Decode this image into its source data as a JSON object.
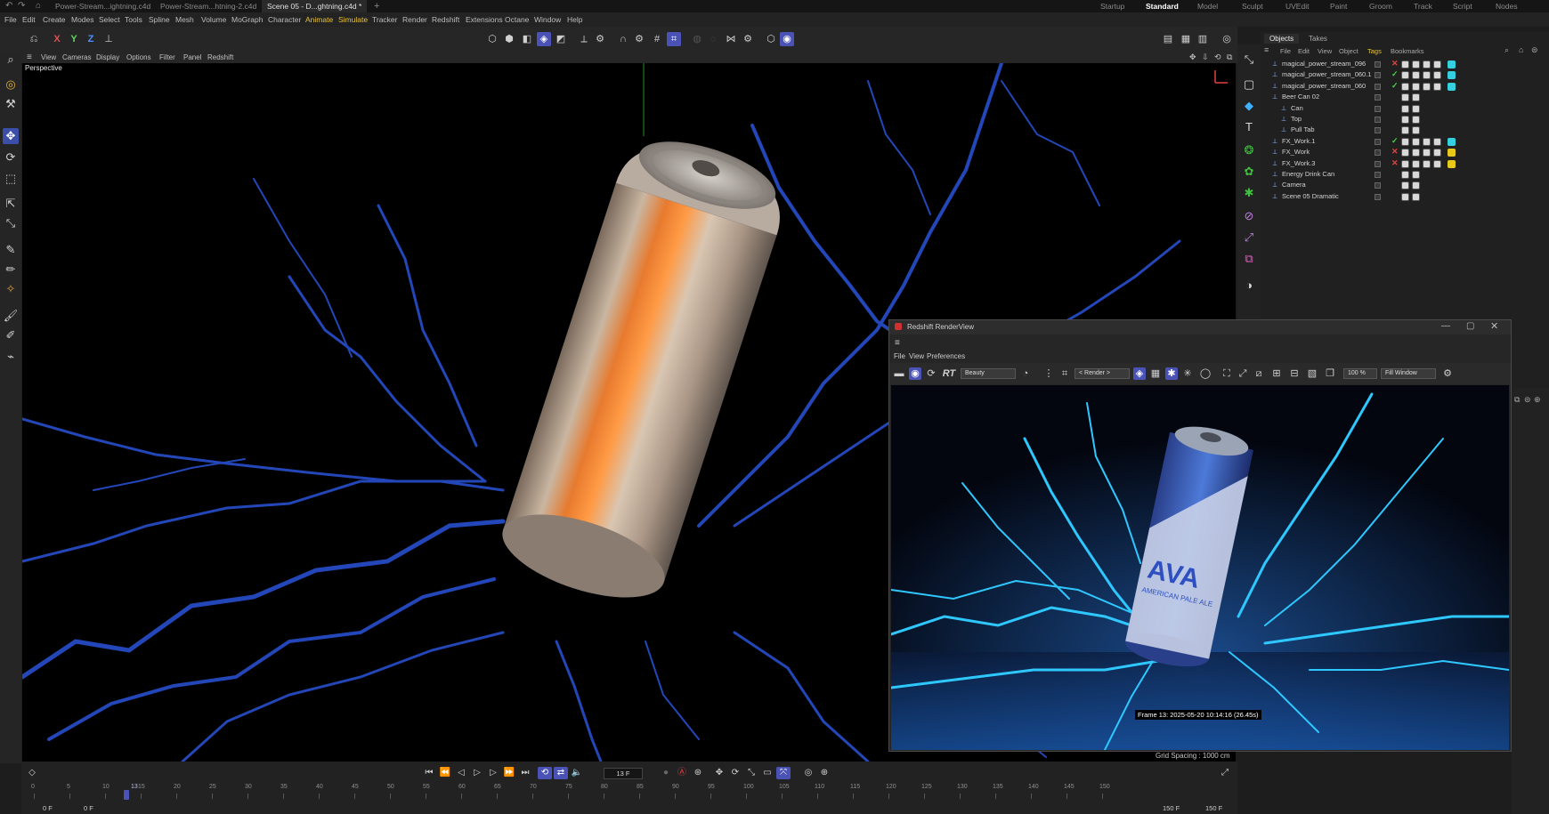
{
  "file_tabs": [
    "Power-Stream...ightning.c4d",
    "Power-Stream...htning-2.c4d",
    "Scene 05 - D...ghtning.c4d *",
    "+"
  ],
  "layouts": [
    "Startup",
    "Standard",
    "Model",
    "Sculpt",
    "UVEdit",
    "Paint",
    "Groom",
    "Track",
    "Script",
    "Nodes"
  ],
  "menu": [
    "File",
    "Edit",
    "Create",
    "Modes",
    "Select",
    "Tools",
    "Spline",
    "Mesh",
    "Volume",
    "MoGraph",
    "Character",
    "Animate",
    "Simulate",
    "Tracker",
    "Render",
    "Redshift",
    "Extensions",
    "Octane",
    "Window",
    "Help"
  ],
  "axis_toggles": [
    "X",
    "Y",
    "Z"
  ],
  "viewport_menu": [
    "View",
    "Cameras",
    "Display",
    "Options",
    "Filter",
    "Panel",
    "Redshift"
  ],
  "viewport_label": "Perspective",
  "grid_spacing": "Grid Spacing : 1000 cm",
  "objects_panel": {
    "tabs": [
      "Objects",
      "Takes"
    ],
    "menu": [
      "File",
      "Edit",
      "View",
      "Object",
      "Tags",
      "Bookmarks"
    ],
    "rows": [
      {
        "name": "magical_power_stream_096",
        "indent": 0,
        "mark": "✕",
        "mark_color": "#e04545",
        "tag_color": "#35d0e0"
      },
      {
        "name": "magical_power_stream_060.1",
        "indent": 0,
        "mark": "✓",
        "mark_color": "#4ccf4c",
        "tag_color": "#35d0e0"
      },
      {
        "name": "magical_power_stream_060",
        "indent": 0,
        "mark": "✓",
        "mark_color": "#4ccf4c",
        "tag_color": "#35d0e0"
      },
      {
        "name": "Beer Can 02",
        "indent": 0,
        "mark": "",
        "mark_color": "",
        "tag_color": ""
      },
      {
        "name": "Can",
        "indent": 1,
        "mark": "",
        "mark_color": "",
        "tag_color": ""
      },
      {
        "name": "Top",
        "indent": 1,
        "mark": "",
        "mark_color": "",
        "tag_color": ""
      },
      {
        "name": "Pull Tab",
        "indent": 1,
        "mark": "",
        "mark_color": "",
        "tag_color": ""
      },
      {
        "name": "FX_Work.1",
        "indent": 0,
        "mark": "✓",
        "mark_color": "#4ccf4c",
        "tag_color": "#35d0e0"
      },
      {
        "name": "FX_Work",
        "indent": 0,
        "mark": "✕",
        "mark_color": "#e04545",
        "tag_color": "#e8c818"
      },
      {
        "name": "FX_Work.3",
        "indent": 0,
        "mark": "✕",
        "mark_color": "#e04545",
        "tag_color": "#e8c818"
      },
      {
        "name": "Energy Drink Can",
        "indent": 0,
        "mark": "",
        "mark_color": "",
        "tag_color": ""
      },
      {
        "name": "Camera",
        "indent": 0,
        "mark": "",
        "mark_color": "",
        "tag_color": ""
      },
      {
        "name": "Scene 05 Dramatic",
        "indent": 0,
        "mark": "",
        "mark_color": "",
        "tag_color": ""
      }
    ]
  },
  "render_view": {
    "title": "Redshift RenderView",
    "menu": [
      "File",
      "View",
      "Preferences"
    ],
    "rt_label": "RT",
    "aov": "Beauty",
    "render_target": "< Render >",
    "zoom": "100 %",
    "fit": "Fill Window",
    "frame_info": "Frame  13:  2025-05-20  10:14:16  (26.45s)",
    "can_brand": "AVA",
    "can_subtitle": "AMERICAN PALE ALE"
  },
  "timeline": {
    "current_frame": "13 F",
    "ticks": [
      "0",
      "5",
      "10",
      "15",
      "20",
      "25",
      "30",
      "35",
      "40",
      "45",
      "50",
      "55",
      "60",
      "65",
      "70",
      "75",
      "80",
      "85",
      "90",
      "95",
      "100",
      "105",
      "110",
      "115",
      "120",
      "125",
      "130",
      "135",
      "140",
      "145",
      "150"
    ],
    "playhead": "13",
    "start_a": "0 F",
    "start_b": "0 F",
    "end_a": "150 F",
    "end_b": "150 F"
  },
  "colors": {
    "accent": "#4a53b5",
    "lightning_viewport": "#2347b8",
    "lightning_render": "#2ec8ff",
    "menu_highlight": "#e8c23a"
  }
}
